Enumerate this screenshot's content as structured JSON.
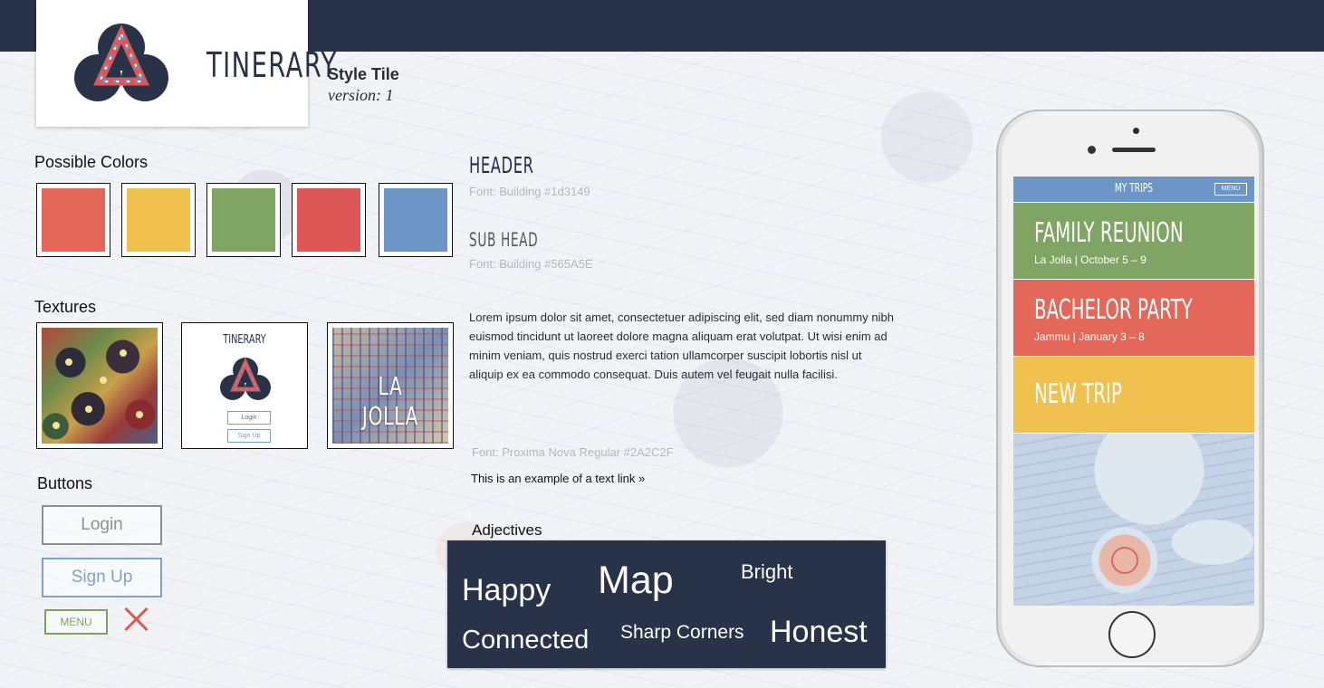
{
  "brand": {
    "name": "TINERARY"
  },
  "tile": {
    "title": "Style Tile",
    "version": "version: 1"
  },
  "colors": {
    "label": "Possible Colors",
    "swatches": [
      "#e4685a",
      "#f0c14f",
      "#7fa463",
      "#dd5756",
      "#6d96c6"
    ]
  },
  "textures": {
    "label": "Textures",
    "mini_brand": "TINERARY",
    "mini_login": "Login",
    "mini_signup": "Sign Up",
    "map_label": "LA JOLLA"
  },
  "buttons": {
    "label": "Buttons",
    "login": "Login",
    "signup": "Sign Up",
    "menu": "MENU"
  },
  "typography": {
    "header": "HEADER",
    "header_note": "Font: Building #1d3149",
    "subhead": "SUB HEAD",
    "subhead_note": "Font: Building #565A5E",
    "body": "Lorem ipsum dolor sit amet, consectetuer adipiscing elit, sed diam nonummy nibh euismod tincidunt ut laoreet dolore magna aliquam erat volutpat. Ut wisi enim ad minim veniam, quis nostrud exerci tation ullamcorper suscipit lobortis nisl ut aliquip ex ea commodo consequat. Duis autem vel feugait nulla facilisi.",
    "body_note": "Font: Proxima Nova Regular #2A2C2F",
    "link": "This is an example of a text link »"
  },
  "adjectives": {
    "label": "Adjectives",
    "words": [
      "Happy",
      "Map",
      "Bright",
      "Connected",
      "Sharp Corners",
      "Honest"
    ]
  },
  "phone": {
    "bar_title": "MY TRIPS",
    "menu_label": "MENU",
    "trips": [
      {
        "title": "FAMILY REUNION",
        "meta": "La Jolla  |  October 5 – 9",
        "color": "#7fa463"
      },
      {
        "title": "BACHELOR PARTY",
        "meta": "Jammu  |  January 3 – 8",
        "color": "#e4685a"
      },
      {
        "title": "NEW TRIP",
        "meta": "",
        "color": "#f0c14f"
      }
    ]
  }
}
